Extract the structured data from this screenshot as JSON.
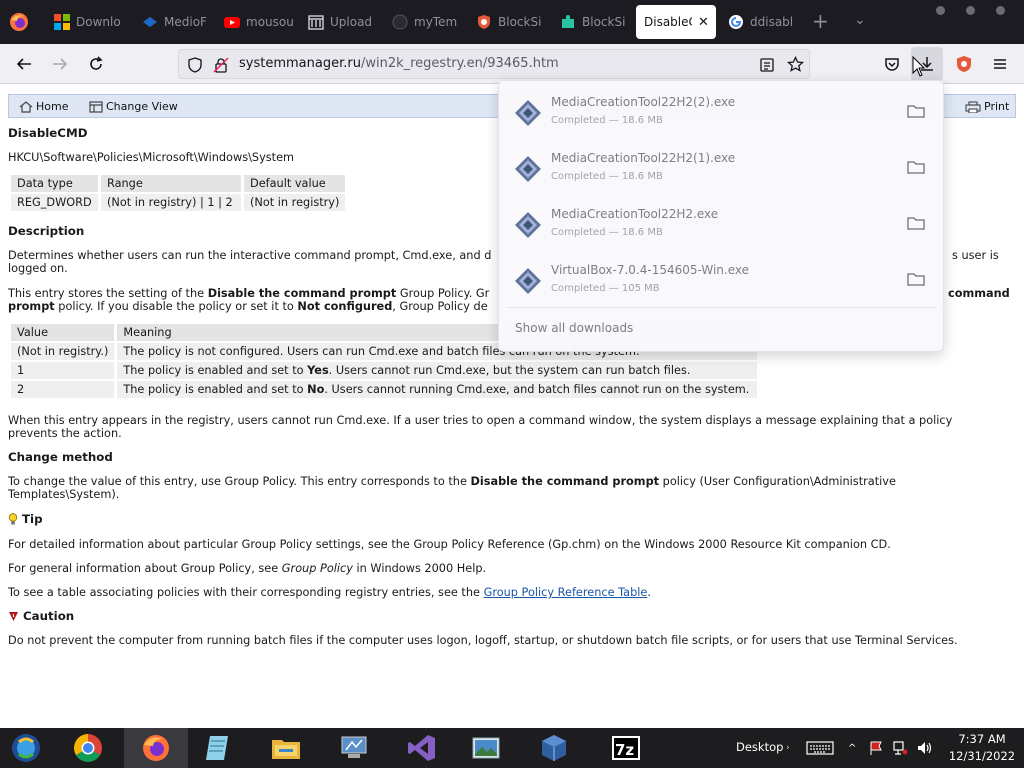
{
  "browser": {
    "tabs": [
      {
        "label": "Downlo",
        "icon": "microsoft-icon"
      },
      {
        "label": "MedioF",
        "icon": "media-icon"
      },
      {
        "label": "mousou",
        "icon": "youtube-icon"
      },
      {
        "label": "Upload",
        "icon": "upload-icon"
      },
      {
        "label": "myTem",
        "icon": "github-icon"
      },
      {
        "label": "BlockSi",
        "icon": "shield-icon"
      },
      {
        "label": "BlockSi",
        "icon": "puzzle-icon"
      },
      {
        "label": "DisableCl",
        "icon": "",
        "active": true
      },
      {
        "label": "ddisabl",
        "icon": "google-icon"
      }
    ],
    "new_tab": "+",
    "url_host": "systemmanager.ru",
    "url_path": "/win2k_regestry.en/93465.htm"
  },
  "page": {
    "nav": {
      "home": "Home",
      "change_view": "Change View",
      "print": "Print"
    },
    "title": "DisableCMD",
    "key_path": "HKCU\\Software\\Policies\\Microsoft\\Windows\\System",
    "type_table": {
      "headers": [
        "Data type",
        "Range",
        "Default value"
      ],
      "row": [
        "REG_DWORD",
        "(Not in registry) | 1 | 2",
        "(Not in registry)"
      ]
    },
    "description_heading": "Description",
    "desc_p1_a": "Determines whether users can run the interactive command prompt, Cmd.exe, and d",
    "desc_p1_b": "s user is",
    "desc_p1_c": "logged on.",
    "desc_p2_a": "This entry stores the setting of the ",
    "desc_p2_b": "Disable the command prompt",
    "desc_p2_c": " Group Policy. Gr",
    "desc_p2_d": "command",
    "desc_p2_e": "prompt",
    "desc_p2_f": " policy. If you disable the policy or set it to ",
    "desc_p2_g": "Not configured",
    "desc_p2_h": ", Group Policy de",
    "value_table": {
      "headers": [
        "Value",
        "Meaning"
      ],
      "rows": [
        {
          "value": "(Not in registry.)",
          "m1": "The policy is not configured. Users can run Cmd.exe and batch files can run on the system.",
          "bold": "",
          "m2": ""
        },
        {
          "value": "1",
          "m1": "The policy is enabled and set to ",
          "bold": "Yes",
          "m2": ". Users cannot run Cmd.exe, but the system can run batch files."
        },
        {
          "value": "2",
          "m1": "The policy is enabled and set to ",
          "bold": "No",
          "m2": ". Users cannot running Cmd.exe, and batch files cannot run on the system."
        }
      ]
    },
    "when_p": "When this entry appears in the registry, users cannot run Cmd.exe. If a user tries to open a command window, the system displays a message explaining that a policy prevents the action.",
    "change_heading": "Change method",
    "change_a": "To change the value of this entry, use Group Policy. This entry corresponds to the ",
    "change_b": "Disable the command prompt",
    "change_c": " policy (User Configuration\\Administrative Templates\\System).",
    "tip_heading": "Tip",
    "tip_p1": "For detailed information about particular Group Policy settings, see the Group Policy Reference (Gp.chm) on the Windows 2000 Resource Kit companion CD.",
    "tip_p2_a": "For general information about Group Policy, see ",
    "tip_p2_b": "Group Policy",
    "tip_p2_c": " in Windows 2000 Help.",
    "tip_p3_a": "To see a table associating policies with their corresponding registry entries, see the ",
    "tip_p3_link": "Group Policy Reference Table",
    "tip_p3_b": ".",
    "caution_heading": "Caution",
    "caution_p": "Do not prevent the computer from running batch files if the computer uses logon, logoff, startup, or shutdown batch file scripts, or for users that use Terminal Services."
  },
  "downloads": {
    "items": [
      {
        "name": "MediaCreationTool22H2(2).exe",
        "status": "Completed — 18.6 MB"
      },
      {
        "name": "MediaCreationTool22H2(1).exe",
        "status": "Completed — 18.6 MB"
      },
      {
        "name": "MediaCreationTool22H2.exe",
        "status": "Completed — 18.6 MB"
      },
      {
        "name": "VirtualBox-7.0.4-154605-Win.exe",
        "status": "Completed — 105 MB"
      }
    ],
    "show_all": "Show all downloads"
  },
  "taskbar": {
    "apps": [
      "start-icon",
      "chrome-icon",
      "firefox-icon",
      "notepad-icon",
      "file-explorer-icon",
      "control-panel-icon",
      "visual-studio-icon",
      "photos-icon",
      "virtualbox-icon",
      "7zip-icon"
    ],
    "desktop": "Desktop",
    "time": "7:37 AM",
    "date": "12/31/2022"
  }
}
